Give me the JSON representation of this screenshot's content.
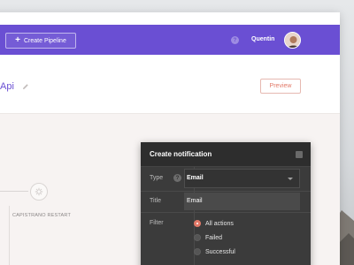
{
  "toolbar": {
    "create_label": "Create Pipeline",
    "plus_glyph": "+",
    "help_glyph": "?",
    "username": "Quentin"
  },
  "header": {
    "title": "Api",
    "preview_label": "Preview"
  },
  "pipeline": {
    "node_label": "CAPISTRANO RESTART"
  },
  "panel": {
    "title": "Create notification",
    "type_label": "Type",
    "type_value": "Email",
    "title_label": "Title",
    "title_value": "Email",
    "filter_label": "Filter",
    "help_glyph": "?",
    "filters": [
      {
        "label": "All actions",
        "checked": true
      },
      {
        "label": "Failed",
        "checked": false
      },
      {
        "label": "Successful",
        "checked": false
      }
    ]
  },
  "colors": {
    "brand": "#6a4fd3",
    "accent": "#e27968",
    "panel": "#3b3b3b"
  },
  "icons": {
    "create": "plus-icon",
    "help": "help-icon",
    "edit": "pencil-icon",
    "save": "save-icon",
    "dropdown": "chevron-down-icon",
    "node": "gear-icon"
  }
}
